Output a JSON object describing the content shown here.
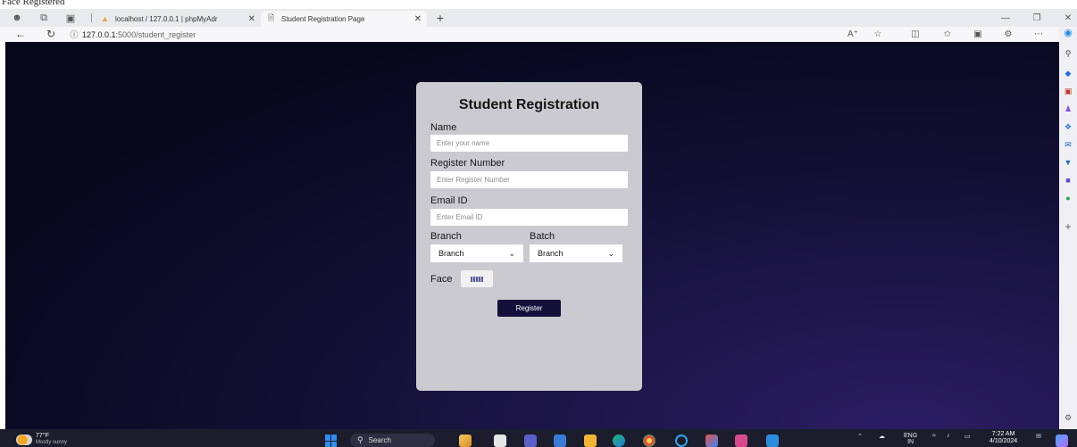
{
  "caption": {
    "text": "Face Registered"
  },
  "browser": {
    "tabs": [
      {
        "title": "localhost / 127.0.0.1 | phpMyAdr",
        "active": false
      },
      {
        "title": "Student Registration Page",
        "active": true
      }
    ],
    "url_host": "127.0.0.1",
    "url_path": ":5000/student_register"
  },
  "form": {
    "title": "Student Registration",
    "name_label": "Name",
    "name_placeholder": "Enter your name",
    "regno_label": "Register Number",
    "regno_placeholder": "Enter Register Number",
    "email_label": "Email ID",
    "email_placeholder": "Enter Email ID",
    "branch_label": "Branch",
    "branch_value": "Branch",
    "batch_label": "Batch",
    "batch_value": "Branch",
    "face_label": "Face",
    "register_label": "Register"
  },
  "taskbar": {
    "weather_temp": "77°F",
    "weather_desc": "Mostly sunny",
    "search_label": "Search",
    "lang": "ENG",
    "lang_sub": "IN",
    "time": "7:22 AM",
    "date": "4/10/2024"
  },
  "colors": {
    "card_bg": "#cbcad0",
    "register_button": "#14103a",
    "page_bg": "#07071b"
  }
}
